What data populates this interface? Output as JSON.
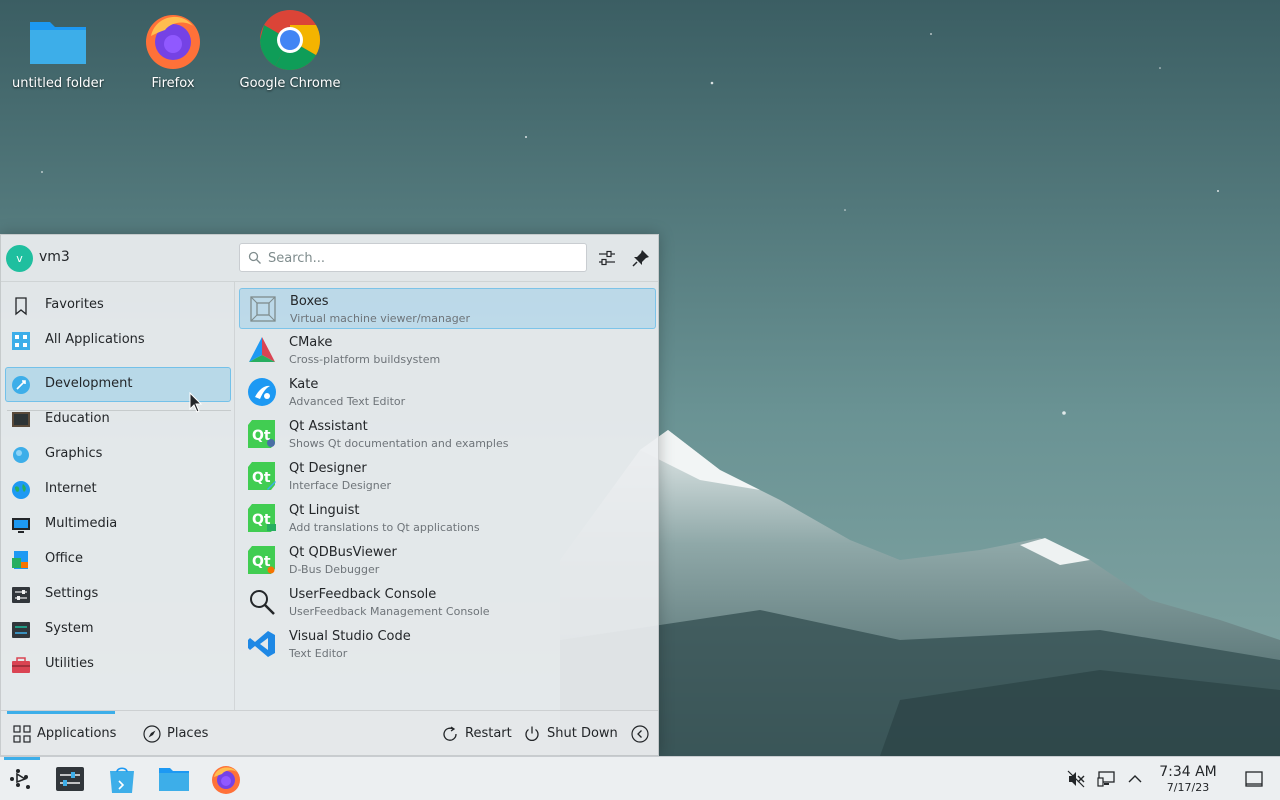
{
  "desktop": {
    "icons": [
      {
        "label": "untitled folder",
        "icon": "folder-icon"
      },
      {
        "label": "Firefox",
        "icon": "firefox-icon"
      },
      {
        "label": "Google Chrome",
        "icon": "chrome-icon"
      }
    ]
  },
  "launcher": {
    "user": {
      "initial": "v",
      "name": "vm3"
    },
    "search": {
      "placeholder": "Search..."
    },
    "header_buttons": [
      "configure-icon",
      "pin-icon"
    ],
    "categories": [
      {
        "label": "Favorites",
        "icon": "bookmark-icon"
      },
      {
        "label": "All Applications",
        "icon": "all-apps-icon"
      },
      {
        "label": "Development",
        "icon": "development-icon",
        "selected": true
      },
      {
        "label": "Education",
        "icon": "education-icon"
      },
      {
        "label": "Graphics",
        "icon": "graphics-icon"
      },
      {
        "label": "Internet",
        "icon": "internet-icon"
      },
      {
        "label": "Multimedia",
        "icon": "multimedia-icon"
      },
      {
        "label": "Office",
        "icon": "office-icon"
      },
      {
        "label": "Settings",
        "icon": "settings-icon"
      },
      {
        "label": "System",
        "icon": "system-icon"
      },
      {
        "label": "Utilities",
        "icon": "utilities-icon"
      }
    ],
    "apps": [
      {
        "name": "Boxes",
        "description": "Virtual machine viewer/manager",
        "icon": "boxes-icon",
        "highlighted": true
      },
      {
        "name": "CMake",
        "description": "Cross-platform buildsystem",
        "icon": "cmake-icon"
      },
      {
        "name": "Kate",
        "description": "Advanced Text Editor",
        "icon": "kate-icon"
      },
      {
        "name": "Qt Assistant",
        "description": "Shows Qt documentation and examples",
        "icon": "qt-assistant-icon"
      },
      {
        "name": "Qt Designer",
        "description": "Interface Designer",
        "icon": "qt-designer-icon"
      },
      {
        "name": "Qt Linguist",
        "description": "Add translations to Qt applications",
        "icon": "qt-linguist-icon"
      },
      {
        "name": "Qt QDBusViewer",
        "description": "D-Bus Debugger",
        "icon": "qt-qdbusviewer-icon"
      },
      {
        "name": "UserFeedback Console",
        "description": "UserFeedback Management Console",
        "icon": "magnifier-icon"
      },
      {
        "name": "Visual Studio Code",
        "description": "Text Editor",
        "icon": "vscode-icon"
      }
    ],
    "footer": {
      "applications_tab": "Applications",
      "places_tab": "Places",
      "restart": "Restart",
      "shut_down": "Shut Down"
    }
  },
  "taskbar": {
    "pinned": [
      "app-launcher-icon",
      "system-settings-icon",
      "discover-icon",
      "dolphin-icon",
      "firefox-icon"
    ],
    "tray": [
      "volume-muted-icon",
      "network-icon",
      "tray-expand-icon"
    ],
    "clock": {
      "time": "7:34 AM",
      "date": "7/17/23"
    },
    "show_desktop": "show-desktop-icon"
  },
  "colors": {
    "accent": "#3daee9",
    "avatar": "#1fbf9f",
    "panel": "#eceff1"
  }
}
